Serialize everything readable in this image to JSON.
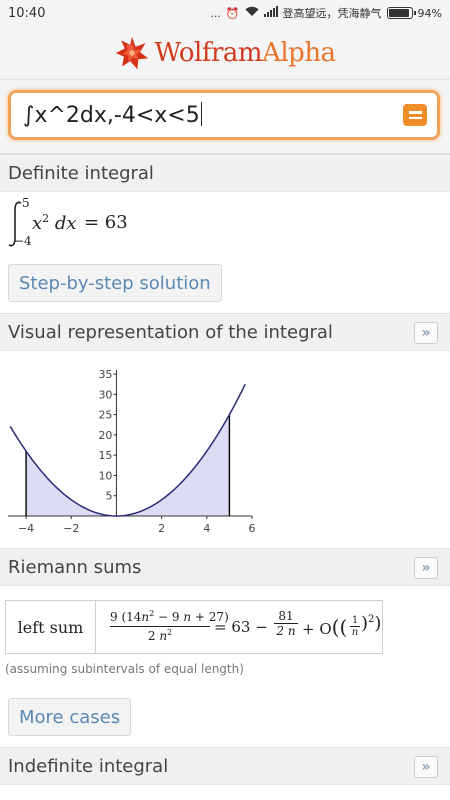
{
  "status_bar": {
    "time": "10:40",
    "dots": "...",
    "carrier": "登高望远，凭海静气",
    "battery": "94%"
  },
  "header": {
    "logo_text_main": "Wolfram",
    "logo_text_accent": "Alpha"
  },
  "search": {
    "query": "∫x^2dx,-4<x<5"
  },
  "pods": {
    "definite": {
      "title": "Definite integral",
      "upper": "5",
      "lower": "−4",
      "integrand": "x",
      "power": "2",
      "dx": "d",
      "var": "x",
      "result": "= 63",
      "button": "Step-by-step solution"
    },
    "visual": {
      "title": "Visual representation of the integral",
      "more": "»"
    },
    "riemann": {
      "title": "Riemann sums",
      "more": "»",
      "row_label": "left sum",
      "numer_a": "9 (14",
      "numer_b": "n",
      "numer_c": "2",
      "numer_d": " − 9 ",
      "numer_e": "n",
      "numer_f": " + 27)",
      "denom_a": "2 ",
      "denom_b": "n",
      "denom_c": "2",
      "eq": "= 63 −",
      "frac2_num": "81",
      "frac2_den": "2 n",
      "plus": "+ O",
      "inner_num": "1",
      "inner_den": "n",
      "outer_pow": "2",
      "assumption": "(assuming subintervals of equal length)",
      "button": "More cases"
    },
    "indefinite": {
      "title": "Indefinite integral",
      "more": "»"
    }
  },
  "chart_data": {
    "type": "area",
    "function": "x^2",
    "shaded_interval": [
      -4,
      5
    ],
    "x": [
      -4.7,
      -4,
      -3,
      -2,
      -1,
      0,
      1,
      2,
      3,
      4,
      5,
      5.7
    ],
    "y": [
      22.09,
      16,
      9,
      4,
      1,
      0,
      1,
      4,
      9,
      16,
      25,
      32.49
    ],
    "x_ticks": [
      "−4",
      "−2",
      "2",
      "4",
      "6"
    ],
    "x_tick_values": [
      -4,
      -2,
      2,
      4,
      6
    ],
    "y_ticks": [
      "5",
      "10",
      "15",
      "20",
      "25",
      "30",
      "35"
    ],
    "y_tick_values": [
      5,
      10,
      15,
      20,
      25,
      30,
      35
    ],
    "xlim": [
      -4.8,
      6
    ],
    "ylim": [
      0,
      36
    ],
    "colors": {
      "curve": "#2b2b7a",
      "fill": "#dcdcf5",
      "axes": "#333333"
    }
  }
}
